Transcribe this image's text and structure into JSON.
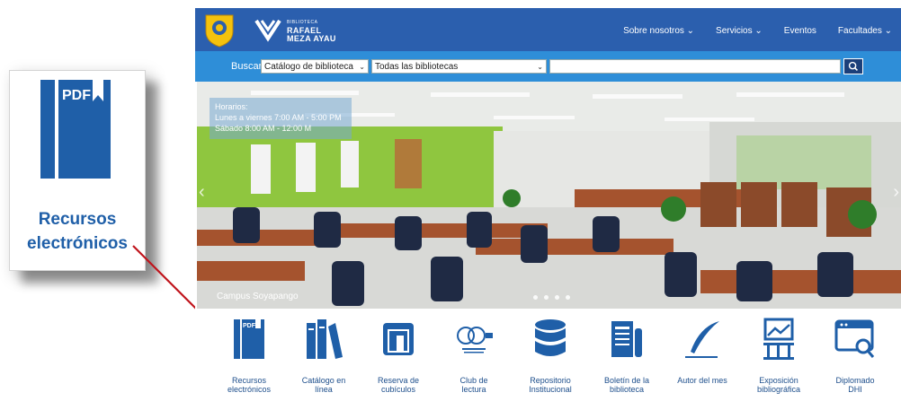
{
  "callout": {
    "label": "Recursos\nelectrónicos",
    "badge": "PDF"
  },
  "header": {
    "logo_small": "BIBLIOTECA",
    "logo_line1": "RAFAEL",
    "logo_line2": "MEZA AYAU",
    "menu": [
      {
        "label": "Sobre nosotros ⌄"
      },
      {
        "label": "Servicios ⌄"
      },
      {
        "label": "Eventos"
      },
      {
        "label": "Facultades ⌄"
      }
    ]
  },
  "search": {
    "label": "Buscar",
    "catalog_select": "Catálogo de biblioteca",
    "library_select": "Todas las bibliotecas",
    "query": "",
    "button_icon": "search-icon"
  },
  "hero": {
    "hours_title": "Horarios:",
    "hours_weekday": "Lunes a viernes 7:00 AM - 5:00 PM",
    "hours_saturday": "Sábado 8:00 AM - 12:00 M",
    "caption": "Campus Soyapango",
    "slide_count": 4
  },
  "services": [
    {
      "label": "Recursos\nelectrónicos",
      "icon": "pdf-book-icon"
    },
    {
      "label": "Catálogo en\nlínea",
      "icon": "books-icon"
    },
    {
      "label": "Reserva de\ncubículos",
      "icon": "room-icon"
    },
    {
      "label": "Club de\nlectura",
      "icon": "club-logo-icon"
    },
    {
      "label": "Repositorio\nInstitucional",
      "icon": "database-icon"
    },
    {
      "label": "Boletín de la\nbiblioteca",
      "icon": "newsletter-icon"
    },
    {
      "label": "Autor del mes",
      "icon": "quill-icon"
    },
    {
      "label": "Exposición\nbibliográfica",
      "icon": "exhibit-icon"
    },
    {
      "label": "Diplomado\nDHI",
      "icon": "web-search-icon"
    }
  ],
  "colors": {
    "nav": "#2b5fae",
    "search_bar": "#2e8ed8",
    "icon_blue": "#1f5fa8",
    "arrow": "#c0141c"
  }
}
